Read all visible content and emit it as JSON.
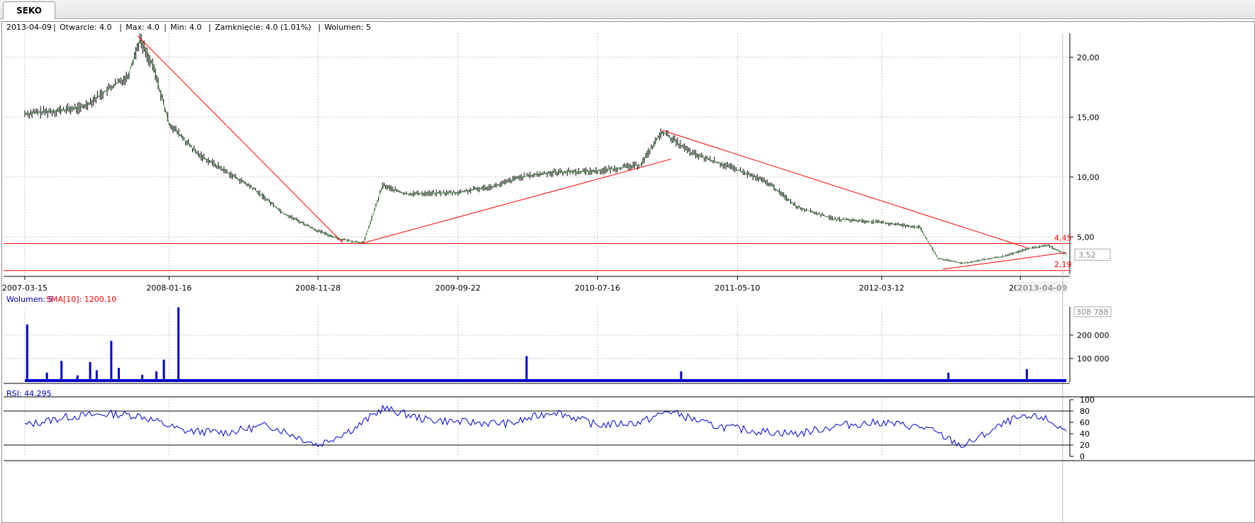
{
  "tabs": [
    {
      "label": "SEKO"
    }
  ],
  "info_bar": {
    "date": "2013-04-09",
    "open": "Otwarcie: 4.0",
    "max": "Max: 4.0",
    "min": "Min: 4.0",
    "close": "Zamknięcie: 4.0 (1.01%)",
    "volume": "Wolumen: 5"
  },
  "colors": {
    "price": "#000000",
    "price_highlight": "#1a8f1a",
    "trendline": "#ff0000",
    "volume": "#0000cc",
    "sma": "#ff0000",
    "rsi": "#0000cc",
    "grid": "#c8c8c8"
  },
  "chart_data": [
    {
      "type": "line",
      "name": "price",
      "date_axis": [
        "2007-03-15",
        "2008-01-16",
        "2008-11-28",
        "2009-09-22",
        "2010-07-16",
        "2011-05-10",
        "2012-03-12",
        "2013-"
      ],
      "current_date_label": "2013-04-09",
      "y_ticks": [
        "5,00",
        "10,00",
        "15,00",
        "20,00"
      ],
      "ylim": [
        2.0,
        22.0
      ],
      "last_value_label": "3,52",
      "last_value": 3.52,
      "grid": true,
      "x": [
        "2007-03-15",
        "2007-05-15",
        "2007-07-15",
        "2007-09-15",
        "2007-10-20",
        "2007-11-15",
        "2007-12-15",
        "2008-01-16",
        "2008-03-15",
        "2008-05-15",
        "2008-07-15",
        "2008-09-15",
        "2008-11-28",
        "2009-01-15",
        "2009-03-05",
        "2009-04-15",
        "2009-06-01",
        "2009-09-22",
        "2009-12-15",
        "2010-02-01",
        "2010-04-15",
        "2010-07-16",
        "2010-10-15",
        "2010-12-01",
        "2011-02-01",
        "2011-05-10",
        "2011-07-15",
        "2011-09-15",
        "2011-12-01",
        "2012-03-12",
        "2012-06-01",
        "2012-07-10",
        "2012-09-01",
        "2012-12-01",
        "2013-01-15",
        "2013-03-01",
        "2013-04-09"
      ],
      "y": [
        15.3,
        15.5,
        15.8,
        17.5,
        18.4,
        21.5,
        19.0,
        14.5,
        12.0,
        10.5,
        9.0,
        7.0,
        5.5,
        4.8,
        4.5,
        9.3,
        8.6,
        8.7,
        9.3,
        10.0,
        10.4,
        10.5,
        11.0,
        13.8,
        12.0,
        10.6,
        9.5,
        7.5,
        6.5,
        6.2,
        5.8,
        3.2,
        2.8,
        3.4,
        4.0,
        4.3,
        3.52
      ],
      "horizontal_levels": [
        {
          "value": 4.45,
          "label": "4,45"
        },
        {
          "value": 2.19,
          "label": "2,19"
        }
      ],
      "trendlines": [
        {
          "x1": "2007-11-10",
          "y1": 21.8,
          "x2": "2009-01-20",
          "y2": 4.5
        },
        {
          "x1": "2009-03-05",
          "y1": 4.5,
          "x2": "2010-12-20",
          "y2": 11.5
        },
        {
          "x1": "2010-12-01",
          "y1": 13.9,
          "x2": "2013-01-15",
          "y2": 4.1
        },
        {
          "x1": "2012-07-20",
          "y1": 2.3,
          "x2": "2013-04-09",
          "y2": 3.7
        }
      ]
    },
    {
      "type": "bar",
      "name": "volume",
      "legend": [
        {
          "text": "Wolumen: 5",
          "color": "#0000cc"
        },
        {
          "text": "SMA[10]: 1200.10",
          "color": "#ff0000"
        }
      ],
      "y_ticks": [
        "100 000",
        "200 000"
      ],
      "ylim": [
        0,
        320000
      ],
      "last_value_label": "308 788",
      "bars": [
        {
          "x": "2007-03-20",
          "value": 245000
        },
        {
          "x": "2007-05-01",
          "value": 40000
        },
        {
          "x": "2007-06-01",
          "value": 90000
        },
        {
          "x": "2007-07-05",
          "value": 28000
        },
        {
          "x": "2007-08-01",
          "value": 85000
        },
        {
          "x": "2007-08-15",
          "value": 50000
        },
        {
          "x": "2007-09-15",
          "value": 175000
        },
        {
          "x": "2007-10-01",
          "value": 60000
        },
        {
          "x": "2007-11-20",
          "value": 30000
        },
        {
          "x": "2007-12-20",
          "value": 45000
        },
        {
          "x": "2008-01-05",
          "value": 95000
        },
        {
          "x": "2008-02-05",
          "value": 318000
        },
        {
          "x": "2010-02-15",
          "value": 110000
        },
        {
          "x": "2011-01-10",
          "value": 45000
        },
        {
          "x": "2012-08-01",
          "value": 40000
        },
        {
          "x": "2013-01-15",
          "value": 55000
        }
      ]
    },
    {
      "type": "line",
      "name": "rsi",
      "label": "RSI: 44.295",
      "y_ticks": [
        "0",
        "20",
        "40",
        "60",
        "80",
        "100"
      ],
      "ylim": [
        0,
        100
      ],
      "levels": [
        20,
        80
      ],
      "x": [
        "2007-03-15",
        "2007-06-15",
        "2007-09-15",
        "2007-11-15",
        "2008-02-15",
        "2008-05-15",
        "2008-08-15",
        "2008-11-28",
        "2009-02-15",
        "2009-04-15",
        "2009-07-15",
        "2009-10-15",
        "2010-01-15",
        "2010-04-15",
        "2010-07-16",
        "2010-10-15",
        "2010-12-15",
        "2011-03-15",
        "2011-06-15",
        "2011-09-15",
        "2011-12-15",
        "2012-03-12",
        "2012-06-15",
        "2012-09-01",
        "2012-12-15",
        "2013-02-15",
        "2013-04-09"
      ],
      "y": [
        55,
        70,
        75,
        72,
        45,
        42,
        55,
        20,
        50,
        85,
        65,
        60,
        58,
        80,
        55,
        60,
        80,
        55,
        45,
        40,
        55,
        60,
        50,
        18,
        65,
        70,
        44.295
      ]
    }
  ]
}
